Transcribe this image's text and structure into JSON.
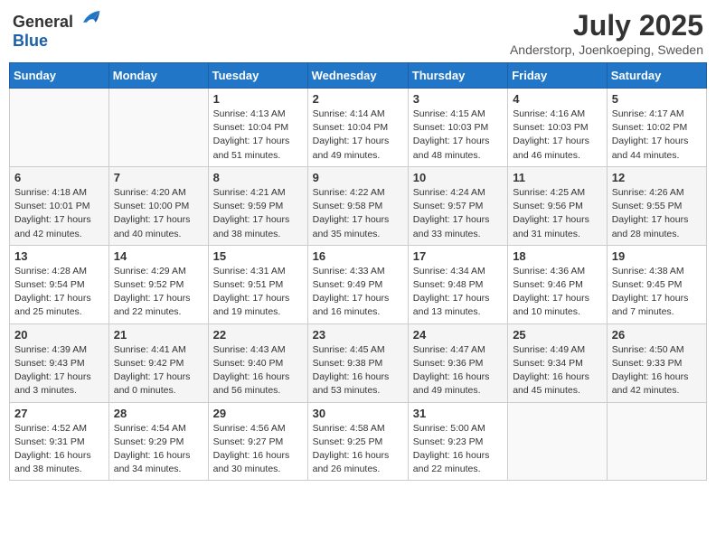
{
  "logo": {
    "general": "General",
    "blue": "Blue"
  },
  "title": "July 2025",
  "subtitle": "Anderstorp, Joenkoeping, Sweden",
  "days_header": [
    "Sunday",
    "Monday",
    "Tuesday",
    "Wednesday",
    "Thursday",
    "Friday",
    "Saturday"
  ],
  "weeks": [
    [
      {
        "day": "",
        "info": ""
      },
      {
        "day": "",
        "info": ""
      },
      {
        "day": "1",
        "info": "Sunrise: 4:13 AM\nSunset: 10:04 PM\nDaylight: 17 hours and 51 minutes."
      },
      {
        "day": "2",
        "info": "Sunrise: 4:14 AM\nSunset: 10:04 PM\nDaylight: 17 hours and 49 minutes."
      },
      {
        "day": "3",
        "info": "Sunrise: 4:15 AM\nSunset: 10:03 PM\nDaylight: 17 hours and 48 minutes."
      },
      {
        "day": "4",
        "info": "Sunrise: 4:16 AM\nSunset: 10:03 PM\nDaylight: 17 hours and 46 minutes."
      },
      {
        "day": "5",
        "info": "Sunrise: 4:17 AM\nSunset: 10:02 PM\nDaylight: 17 hours and 44 minutes."
      }
    ],
    [
      {
        "day": "6",
        "info": "Sunrise: 4:18 AM\nSunset: 10:01 PM\nDaylight: 17 hours and 42 minutes."
      },
      {
        "day": "7",
        "info": "Sunrise: 4:20 AM\nSunset: 10:00 PM\nDaylight: 17 hours and 40 minutes."
      },
      {
        "day": "8",
        "info": "Sunrise: 4:21 AM\nSunset: 9:59 PM\nDaylight: 17 hours and 38 minutes."
      },
      {
        "day": "9",
        "info": "Sunrise: 4:22 AM\nSunset: 9:58 PM\nDaylight: 17 hours and 35 minutes."
      },
      {
        "day": "10",
        "info": "Sunrise: 4:24 AM\nSunset: 9:57 PM\nDaylight: 17 hours and 33 minutes."
      },
      {
        "day": "11",
        "info": "Sunrise: 4:25 AM\nSunset: 9:56 PM\nDaylight: 17 hours and 31 minutes."
      },
      {
        "day": "12",
        "info": "Sunrise: 4:26 AM\nSunset: 9:55 PM\nDaylight: 17 hours and 28 minutes."
      }
    ],
    [
      {
        "day": "13",
        "info": "Sunrise: 4:28 AM\nSunset: 9:54 PM\nDaylight: 17 hours and 25 minutes."
      },
      {
        "day": "14",
        "info": "Sunrise: 4:29 AM\nSunset: 9:52 PM\nDaylight: 17 hours and 22 minutes."
      },
      {
        "day": "15",
        "info": "Sunrise: 4:31 AM\nSunset: 9:51 PM\nDaylight: 17 hours and 19 minutes."
      },
      {
        "day": "16",
        "info": "Sunrise: 4:33 AM\nSunset: 9:49 PM\nDaylight: 17 hours and 16 minutes."
      },
      {
        "day": "17",
        "info": "Sunrise: 4:34 AM\nSunset: 9:48 PM\nDaylight: 17 hours and 13 minutes."
      },
      {
        "day": "18",
        "info": "Sunrise: 4:36 AM\nSunset: 9:46 PM\nDaylight: 17 hours and 10 minutes."
      },
      {
        "day": "19",
        "info": "Sunrise: 4:38 AM\nSunset: 9:45 PM\nDaylight: 17 hours and 7 minutes."
      }
    ],
    [
      {
        "day": "20",
        "info": "Sunrise: 4:39 AM\nSunset: 9:43 PM\nDaylight: 17 hours and 3 minutes."
      },
      {
        "day": "21",
        "info": "Sunrise: 4:41 AM\nSunset: 9:42 PM\nDaylight: 17 hours and 0 minutes."
      },
      {
        "day": "22",
        "info": "Sunrise: 4:43 AM\nSunset: 9:40 PM\nDaylight: 16 hours and 56 minutes."
      },
      {
        "day": "23",
        "info": "Sunrise: 4:45 AM\nSunset: 9:38 PM\nDaylight: 16 hours and 53 minutes."
      },
      {
        "day": "24",
        "info": "Sunrise: 4:47 AM\nSunset: 9:36 PM\nDaylight: 16 hours and 49 minutes."
      },
      {
        "day": "25",
        "info": "Sunrise: 4:49 AM\nSunset: 9:34 PM\nDaylight: 16 hours and 45 minutes."
      },
      {
        "day": "26",
        "info": "Sunrise: 4:50 AM\nSunset: 9:33 PM\nDaylight: 16 hours and 42 minutes."
      }
    ],
    [
      {
        "day": "27",
        "info": "Sunrise: 4:52 AM\nSunset: 9:31 PM\nDaylight: 16 hours and 38 minutes."
      },
      {
        "day": "28",
        "info": "Sunrise: 4:54 AM\nSunset: 9:29 PM\nDaylight: 16 hours and 34 minutes."
      },
      {
        "day": "29",
        "info": "Sunrise: 4:56 AM\nSunset: 9:27 PM\nDaylight: 16 hours and 30 minutes."
      },
      {
        "day": "30",
        "info": "Sunrise: 4:58 AM\nSunset: 9:25 PM\nDaylight: 16 hours and 26 minutes."
      },
      {
        "day": "31",
        "info": "Sunrise: 5:00 AM\nSunset: 9:23 PM\nDaylight: 16 hours and 22 minutes."
      },
      {
        "day": "",
        "info": ""
      },
      {
        "day": "",
        "info": ""
      }
    ]
  ]
}
